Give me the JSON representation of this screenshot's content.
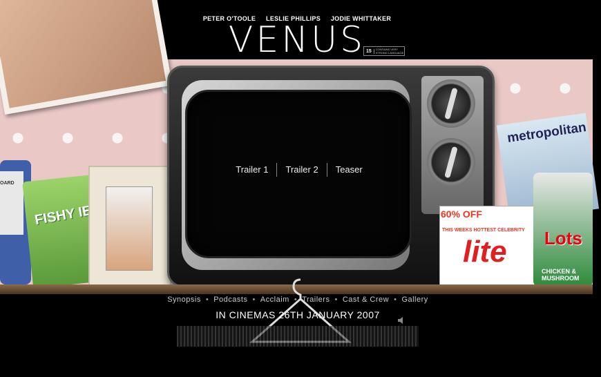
{
  "header": {
    "cast": [
      "PETER O'TOOLE",
      "LESLIE PHILLIPS",
      "JODIE WHITTAKER"
    ],
    "title": "VENUS",
    "rating": {
      "number": "15",
      "text": "CONTAINS VERY STRONG LANGUAGE"
    }
  },
  "tv": {
    "trailers": [
      "Trailer 1",
      "Trailer 2",
      "Teaser"
    ]
  },
  "props": {
    "speaker_text": "OARD",
    "snack_text": "FISHY IES",
    "magazine_title": "metropolitan",
    "lite_promo": "60% OFF",
    "lite_subtitle": "THIS WEEKS HOTTEST CELEBRITY",
    "lite_title": "lite",
    "can_text": "Lots",
    "can_flavour": "CHICKEN & MUSHROOM"
  },
  "nav": {
    "items": [
      "Synopsis",
      "Podcasts",
      "Acclaim",
      "Trailers",
      "Cast & Crew",
      "Gallery"
    ],
    "separator": "•"
  },
  "footer": {
    "release": "IN CINEMAS 26TH JANUARY 2007"
  },
  "colors": {
    "background": "#000000",
    "wallpaper": "#e9c8c6",
    "tv_frame": "#1a1a1a"
  }
}
